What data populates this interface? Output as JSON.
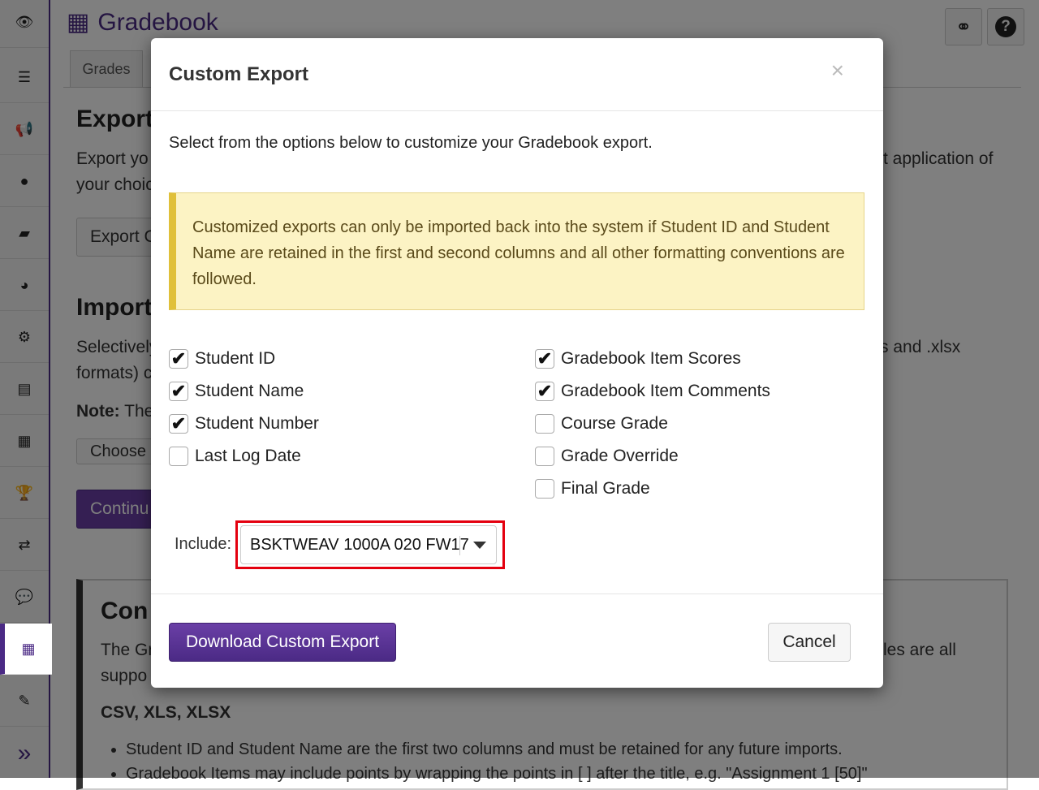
{
  "sidebar": {
    "items": [
      {
        "icon": "eye-icon",
        "glyph": "👁"
      },
      {
        "icon": "list-icon",
        "glyph": "☰"
      },
      {
        "icon": "bullhorn-icon",
        "glyph": "📢"
      },
      {
        "icon": "globe-icon",
        "glyph": "●"
      },
      {
        "icon": "folder-open-icon",
        "glyph": "▰"
      },
      {
        "icon": "pie-chart-icon",
        "glyph": "◕"
      },
      {
        "icon": "gear-icon",
        "glyph": "⚙"
      },
      {
        "icon": "file-icon",
        "glyph": "▤"
      },
      {
        "icon": "calendar-icon",
        "glyph": "▦"
      },
      {
        "icon": "trophy-icon",
        "glyph": "🏆"
      },
      {
        "icon": "exchange-icon",
        "glyph": "⇄"
      },
      {
        "icon": "comments-icon",
        "glyph": "💬"
      },
      {
        "icon": "gradebook-table-icon",
        "glyph": "▦"
      },
      {
        "icon": "pencil-icon",
        "glyph": "✎"
      }
    ],
    "expand_glyph": "»"
  },
  "header": {
    "title": "Gradebook",
    "tab": "Grades",
    "link_glyph": "⚭",
    "help_glyph": "?"
  },
  "background": {
    "export_heading": "Export",
    "export_text_1": "Export yo",
    "export_text_1_right": "t application of",
    "export_text_2": "your choic",
    "export_button": "Export C",
    "import_heading": "Import",
    "import_text_1": "Selectively",
    "import_text_1_right": "s and .xlsx",
    "import_text_2": "formats) c",
    "note_label": "Note:",
    "note_text": "The",
    "choose_button": "Choose F",
    "continue_button": "Continu",
    "conv_heading": "Con",
    "conv_text_1": "The Gr",
    "conv_text_1_right": "les are all",
    "conv_text_2": "suppo",
    "formats_heading": "CSV, XLS, XLSX",
    "bullets": [
      "Student ID and Student Name are the first two columns and must be retained for any future imports.",
      "Gradebook Items may include points by wrapping the points in [ ] after the title, e.g. \"Assignment 1 [50]\""
    ]
  },
  "modal": {
    "title": "Custom Export",
    "close": "×",
    "intro": "Select from the options below to customize your Gradebook export.",
    "warning": "Customized exports can only be imported back into the system if Student ID and Student Name are retained in the first and second columns and all other formatting conventions are followed.",
    "left_options": [
      {
        "label": "Student ID",
        "checked": true
      },
      {
        "label": "Student Name",
        "checked": true
      },
      {
        "label": "Student Number",
        "checked": true
      },
      {
        "label": "Last Log Date",
        "checked": false
      }
    ],
    "right_options": [
      {
        "label": "Gradebook Item Scores",
        "checked": true
      },
      {
        "label": "Gradebook Item Comments",
        "checked": true
      },
      {
        "label": "Course Grade",
        "checked": false
      },
      {
        "label": "Grade Override",
        "checked": false
      },
      {
        "label": "Final Grade",
        "checked": false
      }
    ],
    "include_label": "Include:",
    "include_value": "BSKTWEAV 1000A 020 FW17",
    "download_button": "Download Custom Export",
    "cancel_button": "Cancel",
    "highlight_color": "#e4000f",
    "accent_color": "#4b2a85"
  }
}
